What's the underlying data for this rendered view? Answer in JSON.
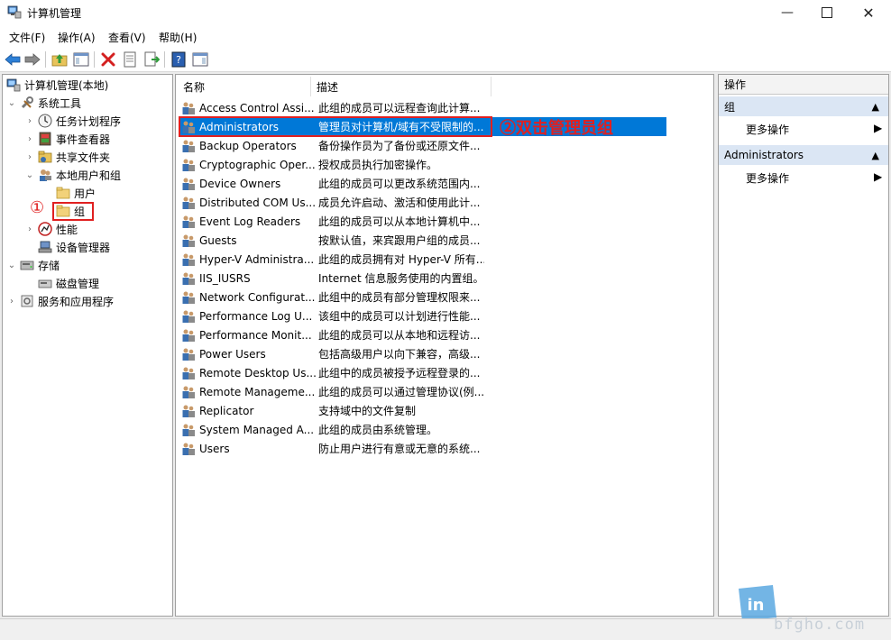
{
  "window": {
    "title": "计算机管理"
  },
  "menu": [
    "文件(F)",
    "操作(A)",
    "查看(V)",
    "帮助(H)"
  ],
  "tree": {
    "root": "计算机管理(本地)",
    "items": [
      {
        "label": "系统工具",
        "level": 1,
        "expander": "open"
      },
      {
        "label": "任务计划程序",
        "level": 2,
        "expander": "closed"
      },
      {
        "label": "事件查看器",
        "level": 2,
        "expander": "closed"
      },
      {
        "label": "共享文件夹",
        "level": 2,
        "expander": "closed"
      },
      {
        "label": "本地用户和组",
        "level": 2,
        "expander": "open"
      },
      {
        "label": "用户",
        "level": 3,
        "expander": "none"
      },
      {
        "label": "组",
        "level": 3,
        "expander": "none"
      },
      {
        "label": "性能",
        "level": 2,
        "expander": "closed"
      },
      {
        "label": "设备管理器",
        "level": 2,
        "expander": "none"
      },
      {
        "label": "存储",
        "level": 1,
        "expander": "open"
      },
      {
        "label": "磁盘管理",
        "level": 2,
        "expander": "none"
      },
      {
        "label": "服务和应用程序",
        "level": 1,
        "expander": "closed"
      }
    ]
  },
  "list": {
    "columns": [
      "名称",
      "描述"
    ],
    "rows": [
      {
        "name": "Access Control Assi...",
        "desc": "此组的成员可以远程查询此计算..."
      },
      {
        "name": "Administrators",
        "desc": "管理员对计算机/域有不受限制的..."
      },
      {
        "name": "Backup Operators",
        "desc": "备份操作员为了备份或还原文件..."
      },
      {
        "name": "Cryptographic Oper...",
        "desc": "授权成员执行加密操作。"
      },
      {
        "name": "Device Owners",
        "desc": "此组的成员可以更改系统范围内..."
      },
      {
        "name": "Distributed COM Us...",
        "desc": "成员允许启动、激活和使用此计..."
      },
      {
        "name": "Event Log Readers",
        "desc": "此组的成员可以从本地计算机中..."
      },
      {
        "name": "Guests",
        "desc": "按默认值，来宾跟用户组的成员..."
      },
      {
        "name": "Hyper-V Administra...",
        "desc": "此组的成员拥有对 Hyper-V 所有..."
      },
      {
        "name": "IIS_IUSRS",
        "desc": "Internet 信息服务使用的内置组。"
      },
      {
        "name": "Network Configurat...",
        "desc": "此组中的成员有部分管理权限来..."
      },
      {
        "name": "Performance Log U...",
        "desc": "该组中的成员可以计划进行性能..."
      },
      {
        "name": "Performance Monit...",
        "desc": "此组的成员可以从本地和远程访..."
      },
      {
        "name": "Power Users",
        "desc": "包括高级用户以向下兼容，高级..."
      },
      {
        "name": "Remote Desktop Us...",
        "desc": "此组中的成员被授予远程登录的..."
      },
      {
        "name": "Remote Manageme...",
        "desc": "此组的成员可以通过管理协议(例..."
      },
      {
        "name": "Replicator",
        "desc": "支持域中的文件复制"
      },
      {
        "name": "System Managed A...",
        "desc": "此组的成员由系统管理。"
      },
      {
        "name": "Users",
        "desc": "防止用户进行有意或无意的系统..."
      }
    ]
  },
  "actions": {
    "header": "操作",
    "sections": [
      {
        "title": "组",
        "item": "更多操作"
      },
      {
        "title": "Administrators",
        "item": "更多操作"
      }
    ]
  },
  "annotations": {
    "step1": "①",
    "step2": "②双击管理员组"
  },
  "watermark": "bfgho.com",
  "colors": {
    "selection": "#0078d7",
    "annotation": "#e02020",
    "action_section_bg": "#dbe6f4"
  }
}
